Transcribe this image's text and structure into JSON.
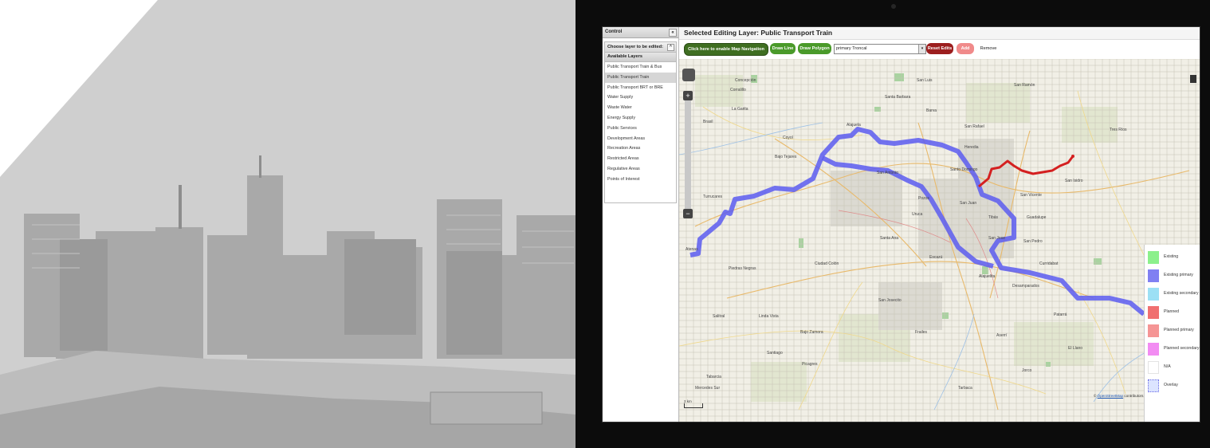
{
  "control": {
    "title": "Control",
    "collapse_symbol": "«",
    "chooser_label": "Choose layer to be edited:",
    "chooser_toggle": "^",
    "available_layers_label": "Available Layers",
    "layers": [
      "Public Transport Train & Bus",
      "Public Transport Train",
      "Public Transport BRT or BRE",
      "Water Supply",
      "Waste Water",
      "Energy Supply",
      "Public Services",
      "Development Areas",
      "Recreation Areas",
      "Restricted Areas",
      "Regulative Areas",
      "Points of Interest"
    ],
    "active_layer_index": 1
  },
  "main": {
    "title": "Selected Editing Layer: Public Transport Train"
  },
  "toolbar": {
    "enable_nav_label": "Click here to enable Map Navigation",
    "draw_line_label": "Draw Line",
    "draw_polygon_label": "Draw Polygon",
    "type_select_value": "primary Troncal",
    "reset_label": "Reset Edits",
    "add_label": "Add",
    "remove_label": "Remove",
    "colors": {
      "green": "#4a9a2a",
      "dark_red": "#9c1e1e",
      "light_red": "#f08a8a"
    }
  },
  "map": {
    "place_labels": [
      "Alajuela",
      "Santa Barbara",
      "San Rafael",
      "Heredia",
      "Santo Domingo",
      "San Antonio",
      "San Isidro",
      "San Vicente",
      "San Juan",
      "San Jose",
      "San Pedro",
      "Santa Ana",
      "Escazú",
      "Curridabat",
      "Aserrí",
      "Desamparados",
      "Alajuelita",
      "Santiago",
      "Tres Ríos",
      "Barva",
      "Guadalupe",
      "Tibás",
      "La Garita",
      "Coyol",
      "Ciudad Colón",
      "Piedras Negras",
      "Salitral",
      "Tabarcia",
      "Mercedes Sur",
      "Tarbaca",
      "Jorco",
      "Corralillo",
      "Linda Vista",
      "Atenas",
      "Turrucares",
      "Bajo Tejares",
      "Concepción",
      "San Luis",
      "Patarrá",
      "San Ramón",
      "Frailes",
      "Brasil",
      "Pozos",
      "Uruca",
      "El Llano",
      "Picagres",
      "San Josecito",
      "Bajo Zamora"
    ],
    "scale_label": "2 km",
    "scale_ratio": "Scale = 1 : 200K",
    "credit_prefix": "© ",
    "credit_link": "OpenStreetMap",
    "credit_suffix": " contributors",
    "line_colors": {
      "existing_primary": "#5c5cf0",
      "planned": "#d42020"
    }
  },
  "legend": {
    "items": [
      {
        "label": "Existing",
        "color": "#8cf08c"
      },
      {
        "label": "Existing primary",
        "color": "#8080f2"
      },
      {
        "label": "Existing secondary",
        "color": "#9ce0f5"
      },
      {
        "label": "Planned",
        "color": "#f07070"
      },
      {
        "label": "Planned primary",
        "color": "#f59595"
      },
      {
        "label": "Planned secondary",
        "color": "#f28cf2"
      },
      {
        "label": "N/A",
        "color": "#ffffff"
      },
      {
        "label": "Overlay",
        "color": "#dce4ff"
      }
    ]
  }
}
